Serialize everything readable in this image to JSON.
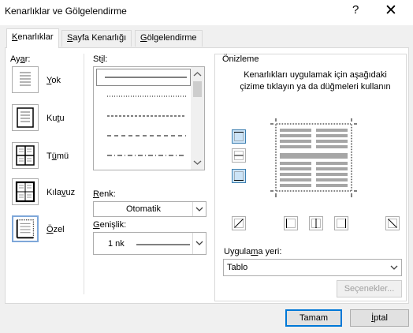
{
  "window": {
    "title": "Kenarlıklar ve Gölgelendirme",
    "help_glyph": "?",
    "close_glyph": "✕"
  },
  "tabs": [
    {
      "pre": "",
      "key": "K",
      "post": "enarlıklar",
      "active": true
    },
    {
      "pre": "",
      "key": "S",
      "post": "ayfa Kenarlığı",
      "active": false
    },
    {
      "pre": "",
      "key": "G",
      "post": "ölgelendirme",
      "active": false
    }
  ],
  "setting": {
    "label_pre": "Ay",
    "label_key": "a",
    "label_post": "r:",
    "items": [
      {
        "pre": "",
        "key": "Y",
        "post": "ok",
        "icon": "border-none-icon"
      },
      {
        "pre": "Ku",
        "key": "t",
        "post": "u",
        "icon": "border-box-icon"
      },
      {
        "pre": "T",
        "key": "ü",
        "post": "mü",
        "icon": "border-all-icon"
      },
      {
        "pre": "Kıla",
        "key": "v",
        "post": "uz",
        "icon": "border-grid-icon"
      },
      {
        "pre": "",
        "key": "Ö",
        "post": "zel",
        "icon": "border-custom-icon",
        "selected": true
      }
    ]
  },
  "style": {
    "label_pre": "St",
    "label_key": "i",
    "label_post": "l:",
    "items": [
      "solid",
      "dotted",
      "dashed-small",
      "dashed",
      "dash-dot"
    ],
    "selected_index": 0
  },
  "color": {
    "label_pre": "",
    "label_key": "R",
    "label_post": "enk:",
    "value": "Otomatik"
  },
  "width": {
    "label_pre": "",
    "label_key": "G",
    "label_post": "enişlik:",
    "value": "1 nk"
  },
  "preview": {
    "title": "Önizleme",
    "instruction": "Kenarlıkları uygulamak için aşağıdaki çizime tıklayın ya da düğmeleri kullanın"
  },
  "apply_to": {
    "label_pre": "Uygula",
    "label_key": "m",
    "label_post": "a yeri:",
    "value": "Tablo"
  },
  "buttons": {
    "options": "Seçenekler...",
    "ok": "Tamam",
    "cancel_pre": "",
    "cancel_key": "İ",
    "cancel_post": "ptal"
  },
  "colors": {
    "accent": "#0078d7",
    "selected_border": "#7ea7d9",
    "disabled_text": "#a0a0a0"
  }
}
